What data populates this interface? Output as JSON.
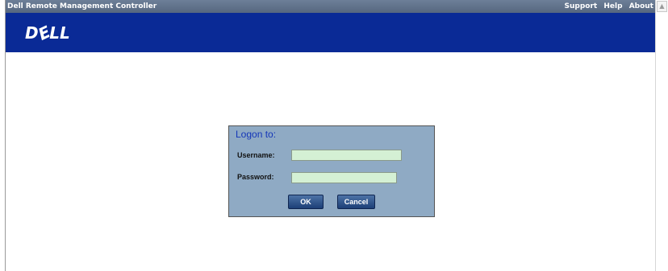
{
  "header": {
    "title": "Dell Remote Management Controller",
    "links": [
      "Support",
      "Help",
      "About"
    ]
  },
  "banner": {
    "logo_text_left": "D",
    "logo_text_mid": "E",
    "logo_text_right": "LL"
  },
  "login": {
    "title": "Logon to:",
    "username_label": "Username:",
    "password_label": "Password:",
    "username_value": "",
    "password_value": "",
    "ok_label": "OK",
    "cancel_label": "Cancel"
  },
  "colors": {
    "header_bar": "#5f7089",
    "banner": "#0a2a96",
    "dialog_bg": "#8faac4",
    "dialog_title": "#1436b8",
    "field_bg": "#d4f0d4",
    "button": "#2a4f86"
  },
  "icons": {
    "scroll_up": "scroll-up-arrow-icon"
  }
}
